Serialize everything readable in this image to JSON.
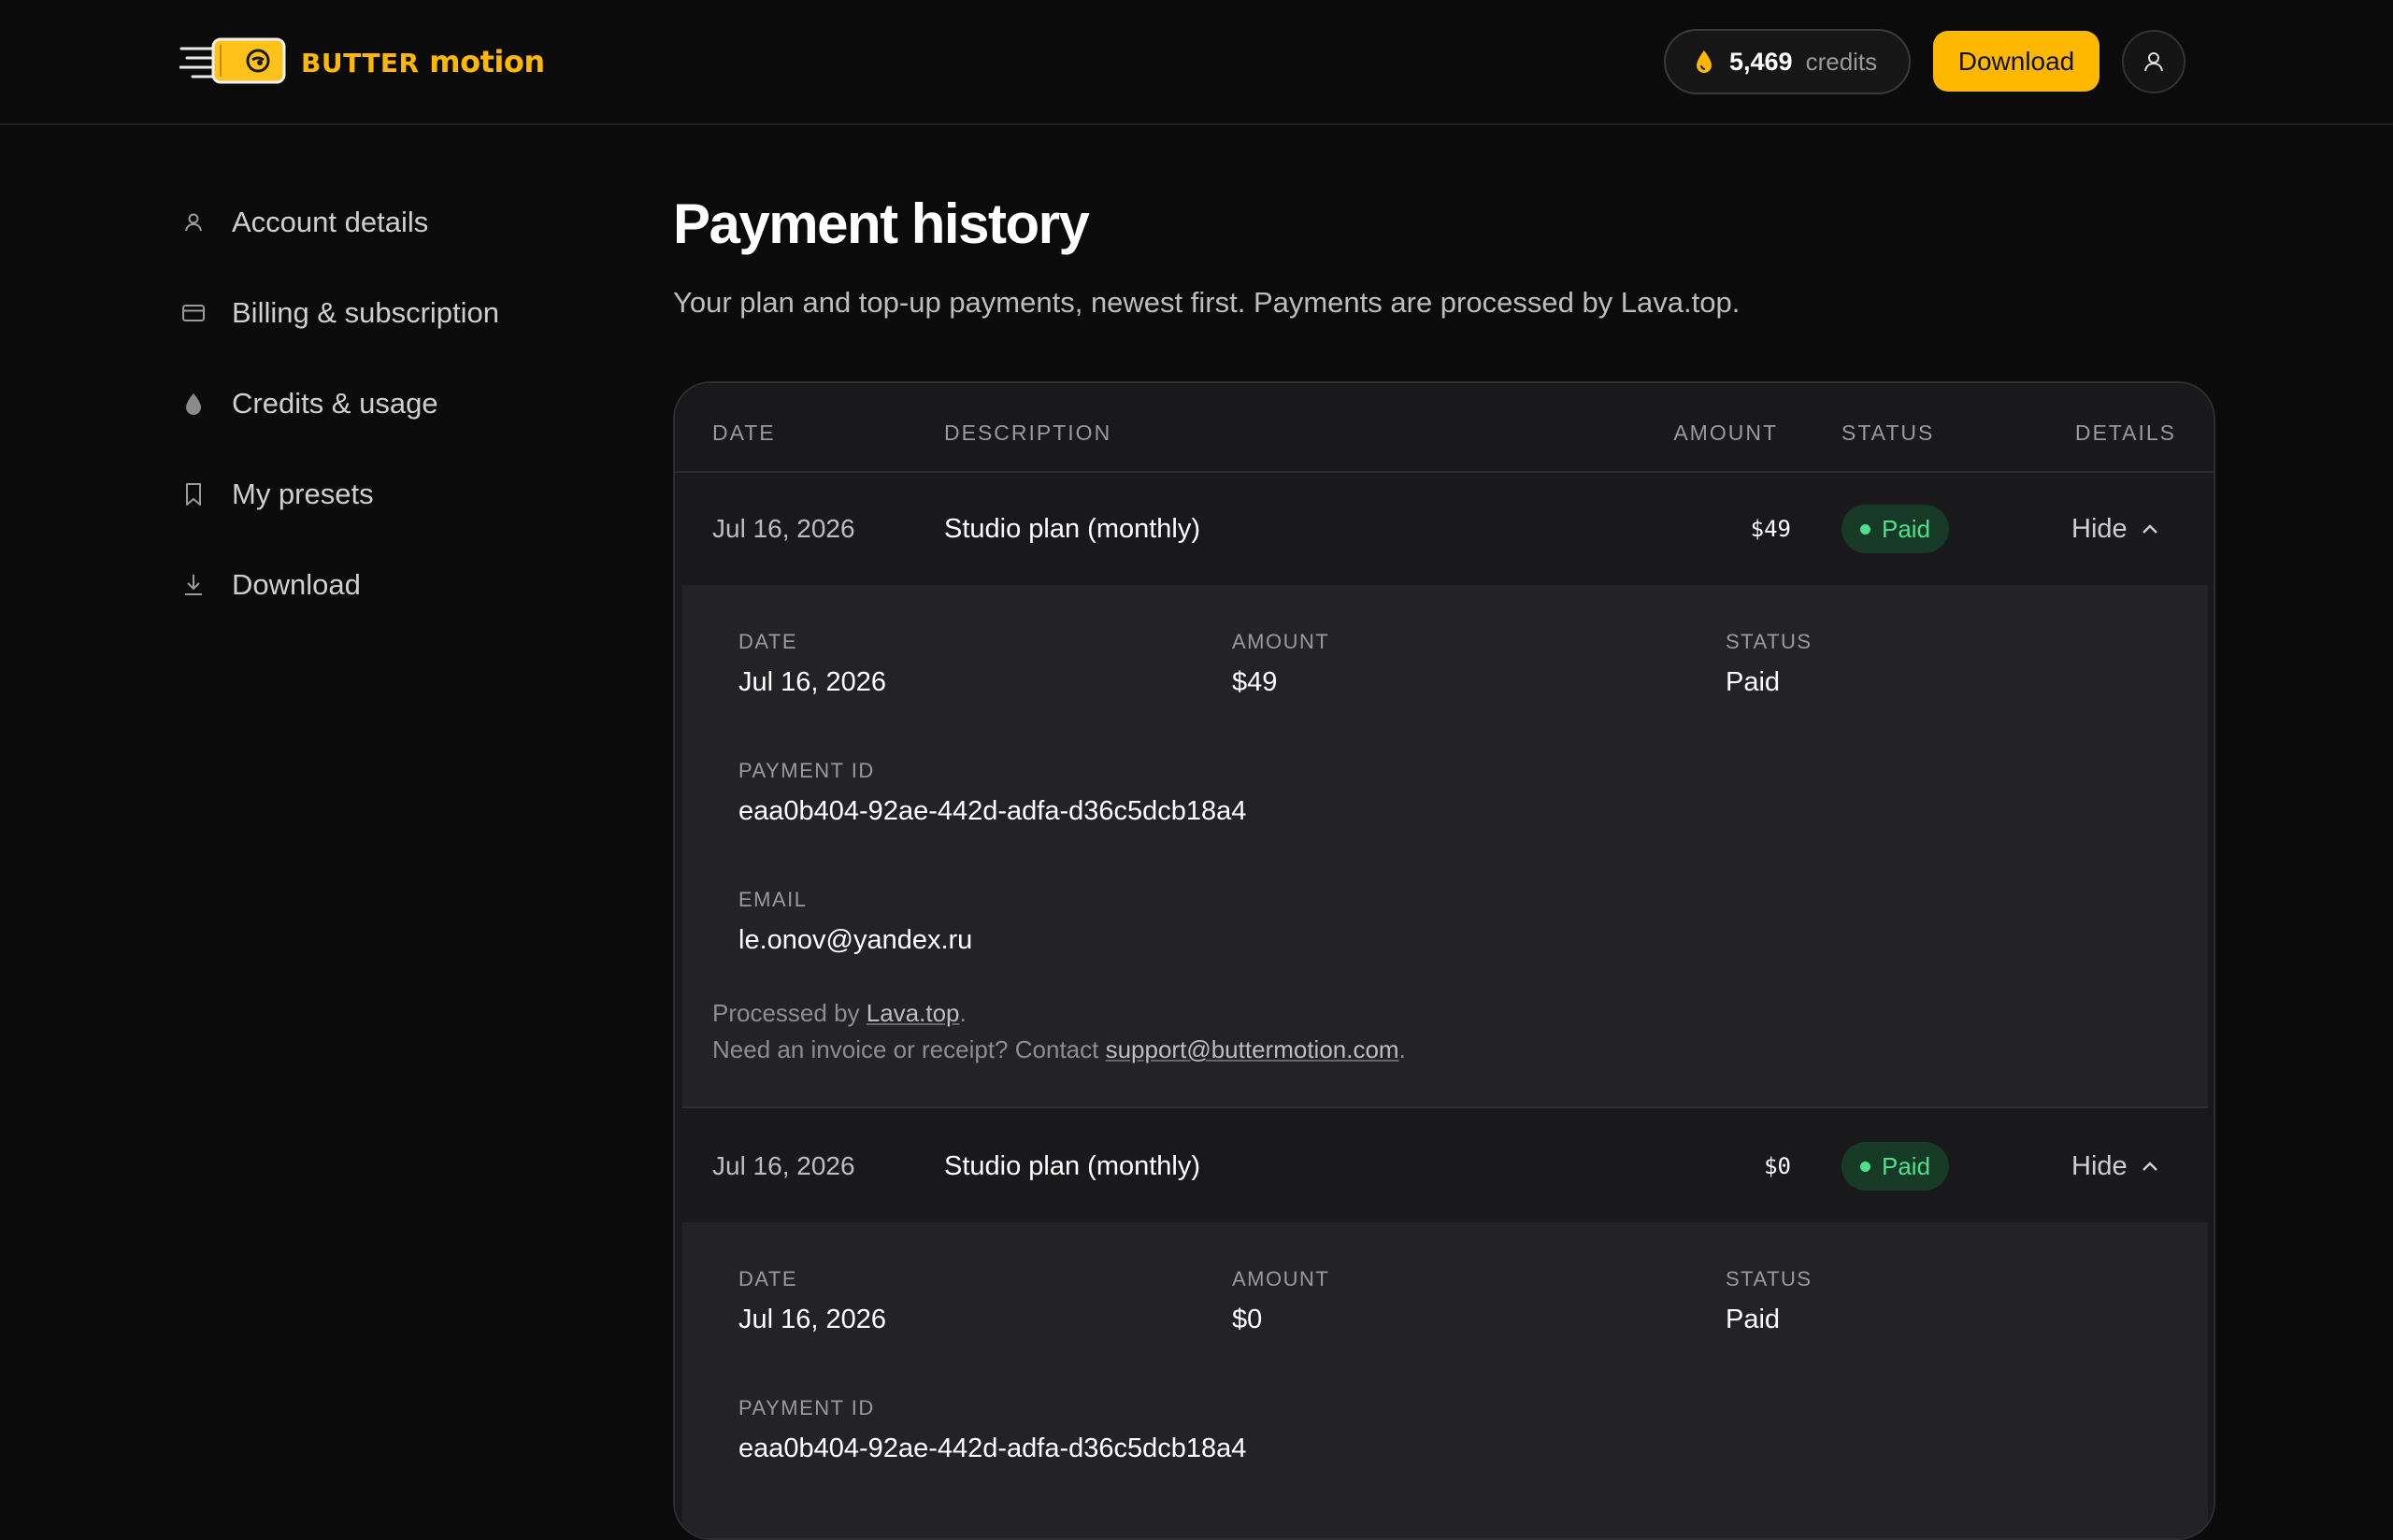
{
  "header": {
    "brand_word1": "BUTTER",
    "brand_word2": "motion",
    "credits_value": "5,469",
    "credits_unit": "credits",
    "download_label": "Download",
    "brand_color": "#ffb800"
  },
  "sidebar": {
    "items": [
      {
        "label": "Account details",
        "icon": "user-icon"
      },
      {
        "label": "Billing & subscription",
        "icon": "credit-card-icon"
      },
      {
        "label": "Credits & usage",
        "icon": "drop-icon"
      },
      {
        "label": "My presets",
        "icon": "bookmark-icon"
      },
      {
        "label": "Download",
        "icon": "download-icon"
      }
    ]
  },
  "main": {
    "title": "Payment history",
    "subtitle": "Your plan and top-up payments, newest first. Payments are processed by Lava.top."
  },
  "table": {
    "headers": {
      "date": "DATE",
      "description": "DESCRIPTION",
      "amount": "AMOUNT",
      "status": "STATUS",
      "details": "DETAILS"
    },
    "rows": [
      {
        "date": "Jul 16, 2026",
        "description": "Studio plan (monthly)",
        "amount": "$49",
        "status": "Paid",
        "toggle": "Hide",
        "details": {
          "date_label": "DATE",
          "date": "Jul 16, 2026",
          "amount_label": "AMOUNT",
          "amount": "$49",
          "status_label": "STATUS",
          "status": "Paid",
          "payment_id_label": "PAYMENT ID",
          "payment_id": "eaa0b404-92ae-442d-adfa-d36c5dcb18a4",
          "email_label": "EMAIL",
          "email": "le.onov@yandex.ru",
          "processed_prefix": "Processed by",
          "processor": "Lava.top",
          "processed_suffix": ".",
          "invoice_prefix": "Need an invoice or receipt? Contact",
          "support_email": "support@buttermotion.com",
          "invoice_suffix": "."
        }
      },
      {
        "date": "Jul 16, 2026",
        "description": "Studio plan (monthly)",
        "amount": "$0",
        "status": "Paid",
        "toggle": "Hide",
        "details": {
          "date_label": "DATE",
          "date": "Jul 16, 2026",
          "amount_label": "AMOUNT",
          "amount": "$0",
          "status_label": "STATUS",
          "status": "Paid",
          "payment_id_label": "PAYMENT ID",
          "payment_id": "eaa0b404-92ae-442d-adfa-d36c5dcb18a4"
        }
      }
    ]
  }
}
